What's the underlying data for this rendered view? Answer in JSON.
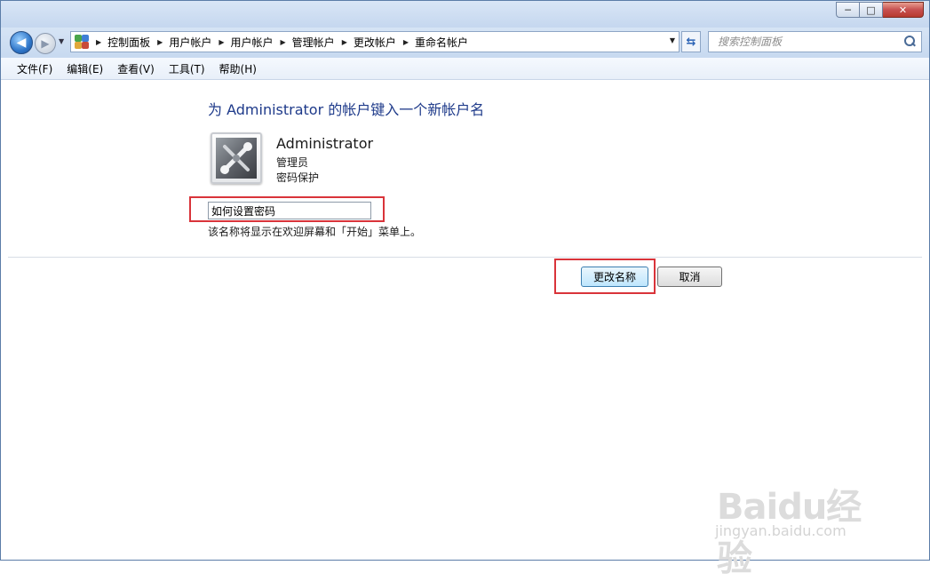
{
  "window": {
    "caption_buttons": {
      "minimize": "─",
      "maximize": "□",
      "close": "✕"
    }
  },
  "navigation": {
    "back_icon": "arrow-left-icon",
    "forward_icon": "arrow-right-icon",
    "breadcrumbs": [
      "控制面板",
      "用户帐户",
      "用户帐户",
      "管理帐户",
      "更改帐户",
      "重命名帐户"
    ],
    "search_placeholder": "搜索控制面板"
  },
  "menu": {
    "items": [
      "文件(F)",
      "编辑(E)",
      "查看(V)",
      "工具(T)",
      "帮助(H)"
    ]
  },
  "content": {
    "heading": "为 Administrator 的帐户键入一个新帐户名",
    "account": {
      "name": "Administrator",
      "role": "管理员",
      "protection": "密码保护",
      "avatar_icon": "tools-avatar-icon"
    },
    "new_name_value": "如何设置密码",
    "hint": "该名称将显示在欢迎屏幕和「开始」菜单上。",
    "change_button": "更改名称",
    "cancel_button": "取消"
  },
  "watermark": {
    "logo": "Baidu经验",
    "url": "jingyan.baidu.com"
  },
  "colors": {
    "heading": "#1e3a8a",
    "highlight": "#d9343a",
    "chrome": "#c7d9f0"
  }
}
